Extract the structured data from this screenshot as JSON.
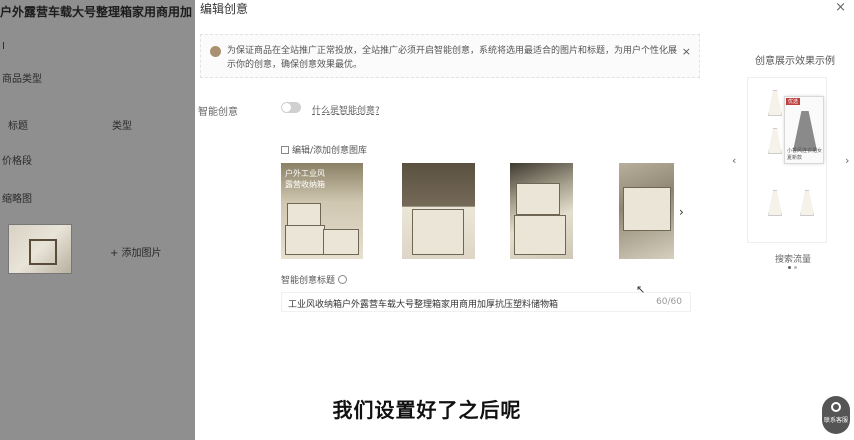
{
  "background_page": {
    "title": "户外露营车载大号整理箱家用商用加",
    "labels": [
      "I",
      "商品类型",
      "标题",
      "类型",
      "价格段",
      "缩略图"
    ],
    "thumb_action": "+ 添加图片"
  },
  "modal": {
    "title": "编辑创意",
    "close": "×",
    "notice": {
      "text": "为保证商品在全站推广正常投放，全站推广必须开启智能创意，系统将选用最适合的图片和标题，为用户个性化展示你的创意，确保创意效果最优。",
      "close": "×"
    },
    "smart_creative": {
      "label": "智能创意",
      "help_link": "什么是智能创意?"
    },
    "gallery": {
      "label": "编辑/添加创意图库",
      "image1_text": "户外工业风\n露营收纳箱",
      "next": "›"
    },
    "smart_title": {
      "label": "智能创意标题",
      "value": "工业风收纳箱户外露营车载大号整理箱家用商用加厚抗压塑料储物箱",
      "count": "60/60"
    }
  },
  "preview": {
    "title": "创意展示效果示例",
    "caption": "搜索流量",
    "prev": "‹",
    "next": "›",
    "tag": "优选",
    "item_caption": "小香风连衣裙女夏新款"
  },
  "subtitle": "我们设置好了之后呢",
  "float_button": {
    "label": "联系客服"
  }
}
